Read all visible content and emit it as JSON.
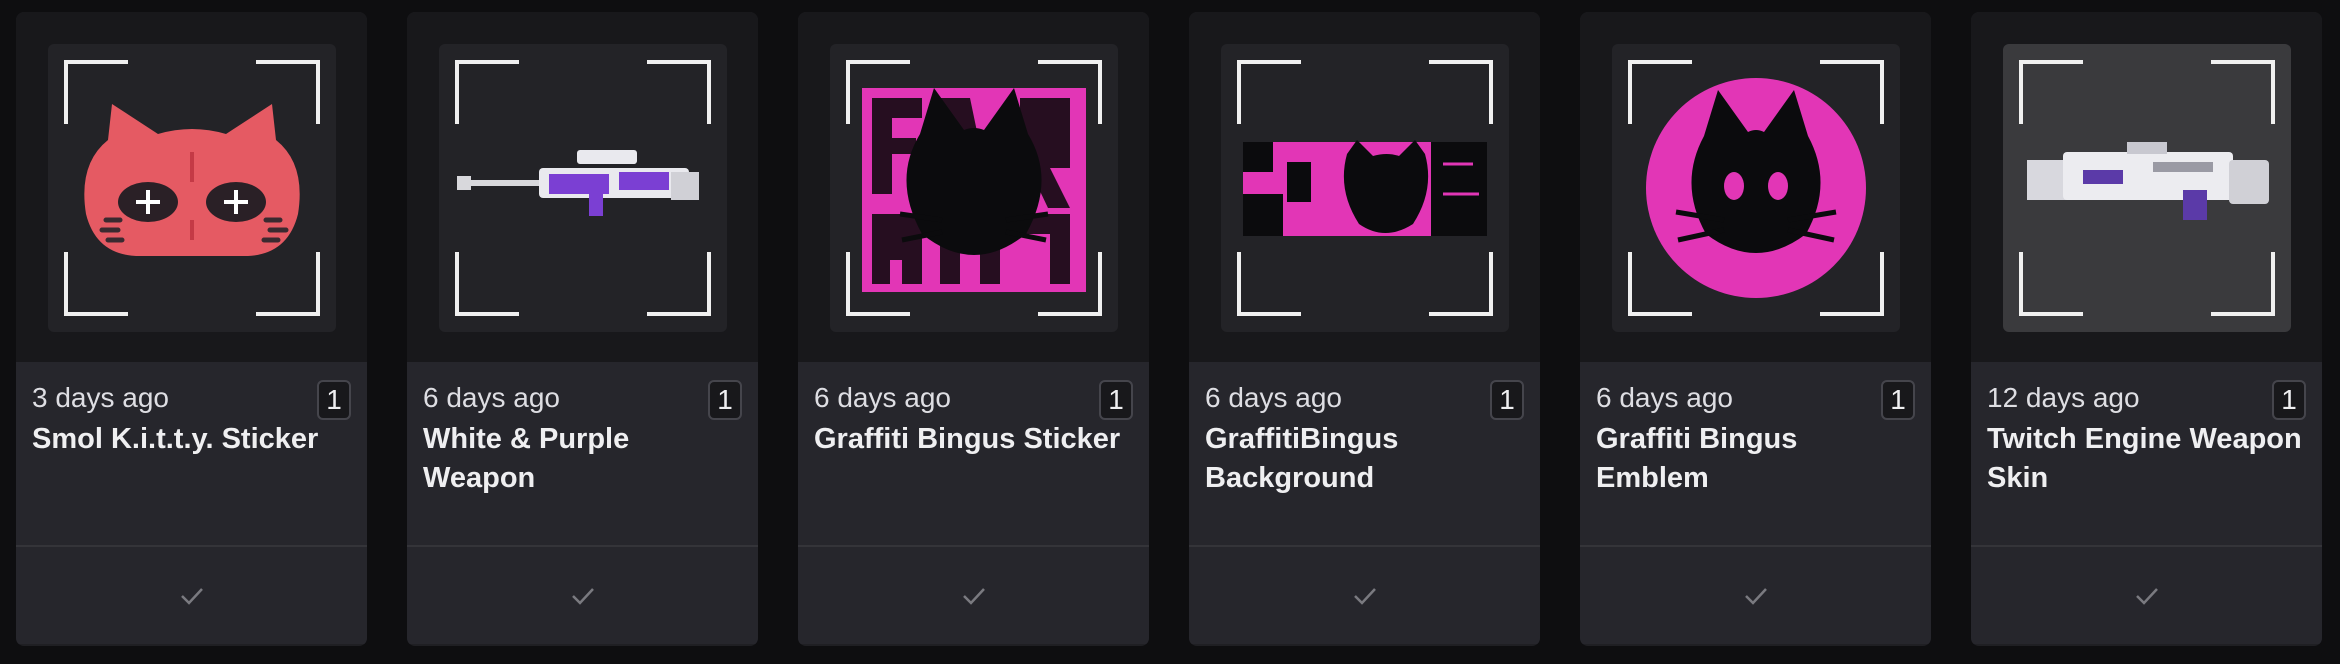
{
  "colors": {
    "background": "#0e0e10",
    "card": "#1f1f23",
    "accent_pink": "#e236b6",
    "sticker_red": "#e55a63",
    "weapon_purple": "#7b3fd3"
  },
  "cards": [
    {
      "time": "3 days ago",
      "qty": "1",
      "title": "Smol K.i.t.t.y. Sticker",
      "icon": "kitty-sticker-icon",
      "check_icon": "check-icon"
    },
    {
      "time": "6 days ago",
      "qty": "1",
      "title": "White & Purple Weapon",
      "icon": "sniper-rifle-icon",
      "check_icon": "check-icon"
    },
    {
      "time": "6 days ago",
      "qty": "1",
      "title": "Graffiti Bingus Sticker",
      "icon": "graffiti-sticker-icon",
      "check_icon": "check-icon"
    },
    {
      "time": "6 days ago",
      "qty": "1",
      "title": "GraffitiBingus Background",
      "icon": "graffiti-background-icon",
      "check_icon": "check-icon"
    },
    {
      "time": "6 days ago",
      "qty": "1",
      "title": "Graffiti Bingus Emblem",
      "icon": "graffiti-emblem-icon",
      "check_icon": "check-icon"
    },
    {
      "time": "12 days ago",
      "qty": "1",
      "title": "Twitch Engine Weapon Skin",
      "icon": "weapon-skin-icon",
      "check_icon": "check-icon"
    }
  ]
}
